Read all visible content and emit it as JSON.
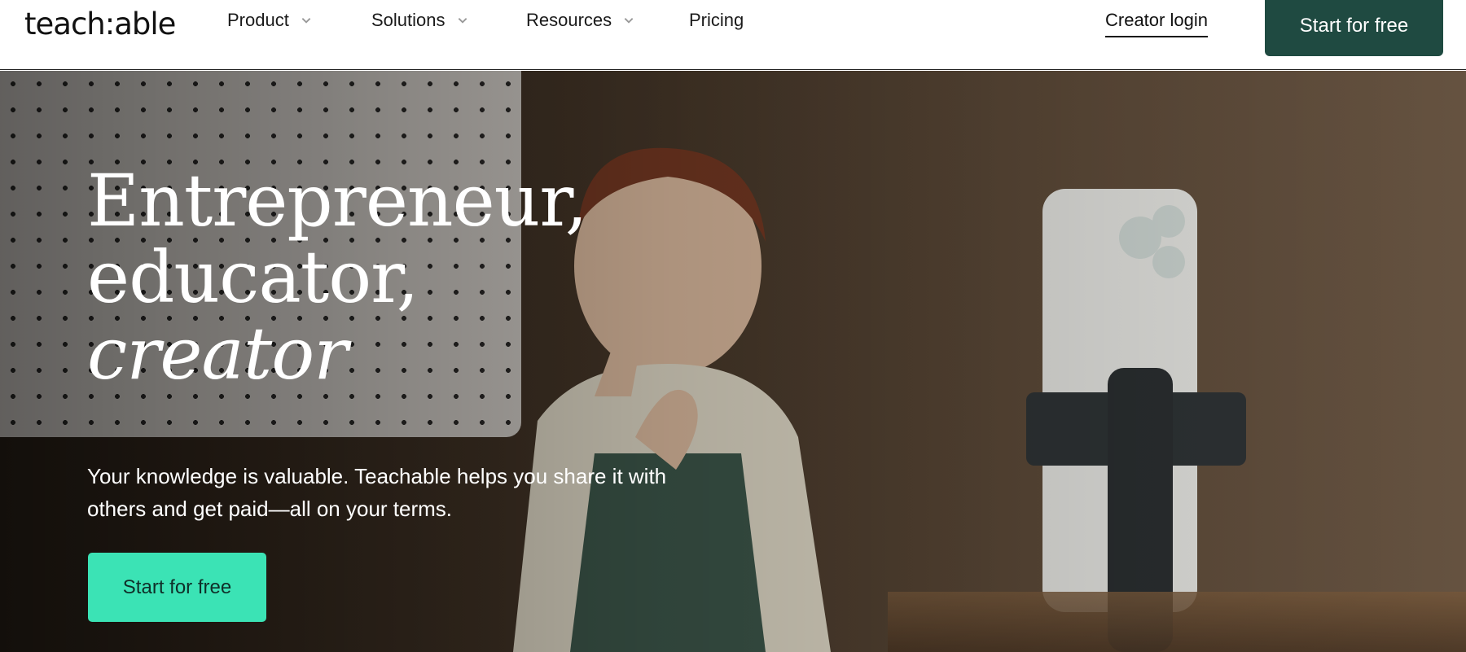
{
  "header": {
    "logo": "teach:able",
    "nav": [
      {
        "label": "Product",
        "has_dropdown": true
      },
      {
        "label": "Solutions",
        "has_dropdown": true
      },
      {
        "label": "Resources",
        "has_dropdown": true
      },
      {
        "label": "Pricing",
        "has_dropdown": false
      }
    ],
    "login_label": "Creator login",
    "cta_label": "Start for free"
  },
  "hero": {
    "headline_line1": "Entrepreneur,",
    "headline_line2": "educator,",
    "headline_line3": "creator",
    "subtext": "Your knowledge is valuable. Teachable helps you share it with others and get paid—all on your terms.",
    "cta_label": "Start for free"
  },
  "colors": {
    "primary_dark": "#1f4a41",
    "accent_mint": "#3be3b5",
    "text_dark": "#111111"
  },
  "icons": {
    "dropdown": "chevron-down-icon"
  }
}
